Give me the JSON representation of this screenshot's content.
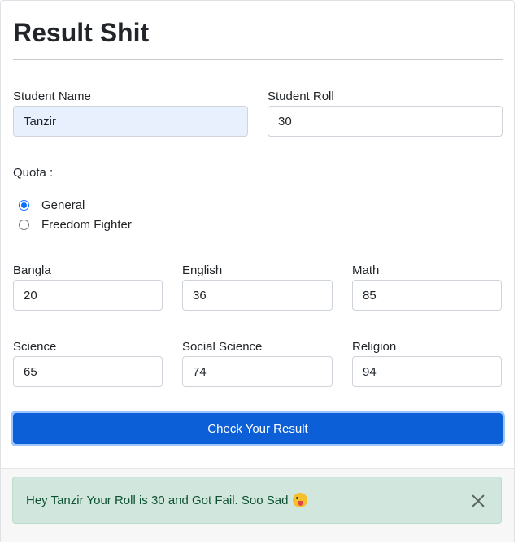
{
  "page": {
    "title": "Result Shit"
  },
  "student": {
    "name_label": "Student Name",
    "name_value": "Tanzir",
    "roll_label": "Student Roll",
    "roll_value": "30"
  },
  "quota": {
    "label": "Quota :",
    "options": [
      {
        "label": "General",
        "checked": true
      },
      {
        "label": "Freedom Fighter",
        "checked": false
      }
    ]
  },
  "subjects": [
    {
      "label": "Bangla",
      "value": "20"
    },
    {
      "label": "English",
      "value": "36"
    },
    {
      "label": "Math",
      "value": "85"
    },
    {
      "label": "Science",
      "value": "65"
    },
    {
      "label": "Social Science",
      "value": "74"
    },
    {
      "label": "Religion",
      "value": "94"
    }
  ],
  "submit": {
    "label": "Check Your Result"
  },
  "alert": {
    "message": "Hey Tanzir Your Roll is 30 and Got Fail. Soo Sad",
    "emoji_icon": "winking-face-with-tongue-icon",
    "close_icon": "close-icon",
    "background": "#d1e7dd"
  },
  "colors": {
    "primary": "#0d5fd8",
    "autofill": "#e8f0fe"
  }
}
